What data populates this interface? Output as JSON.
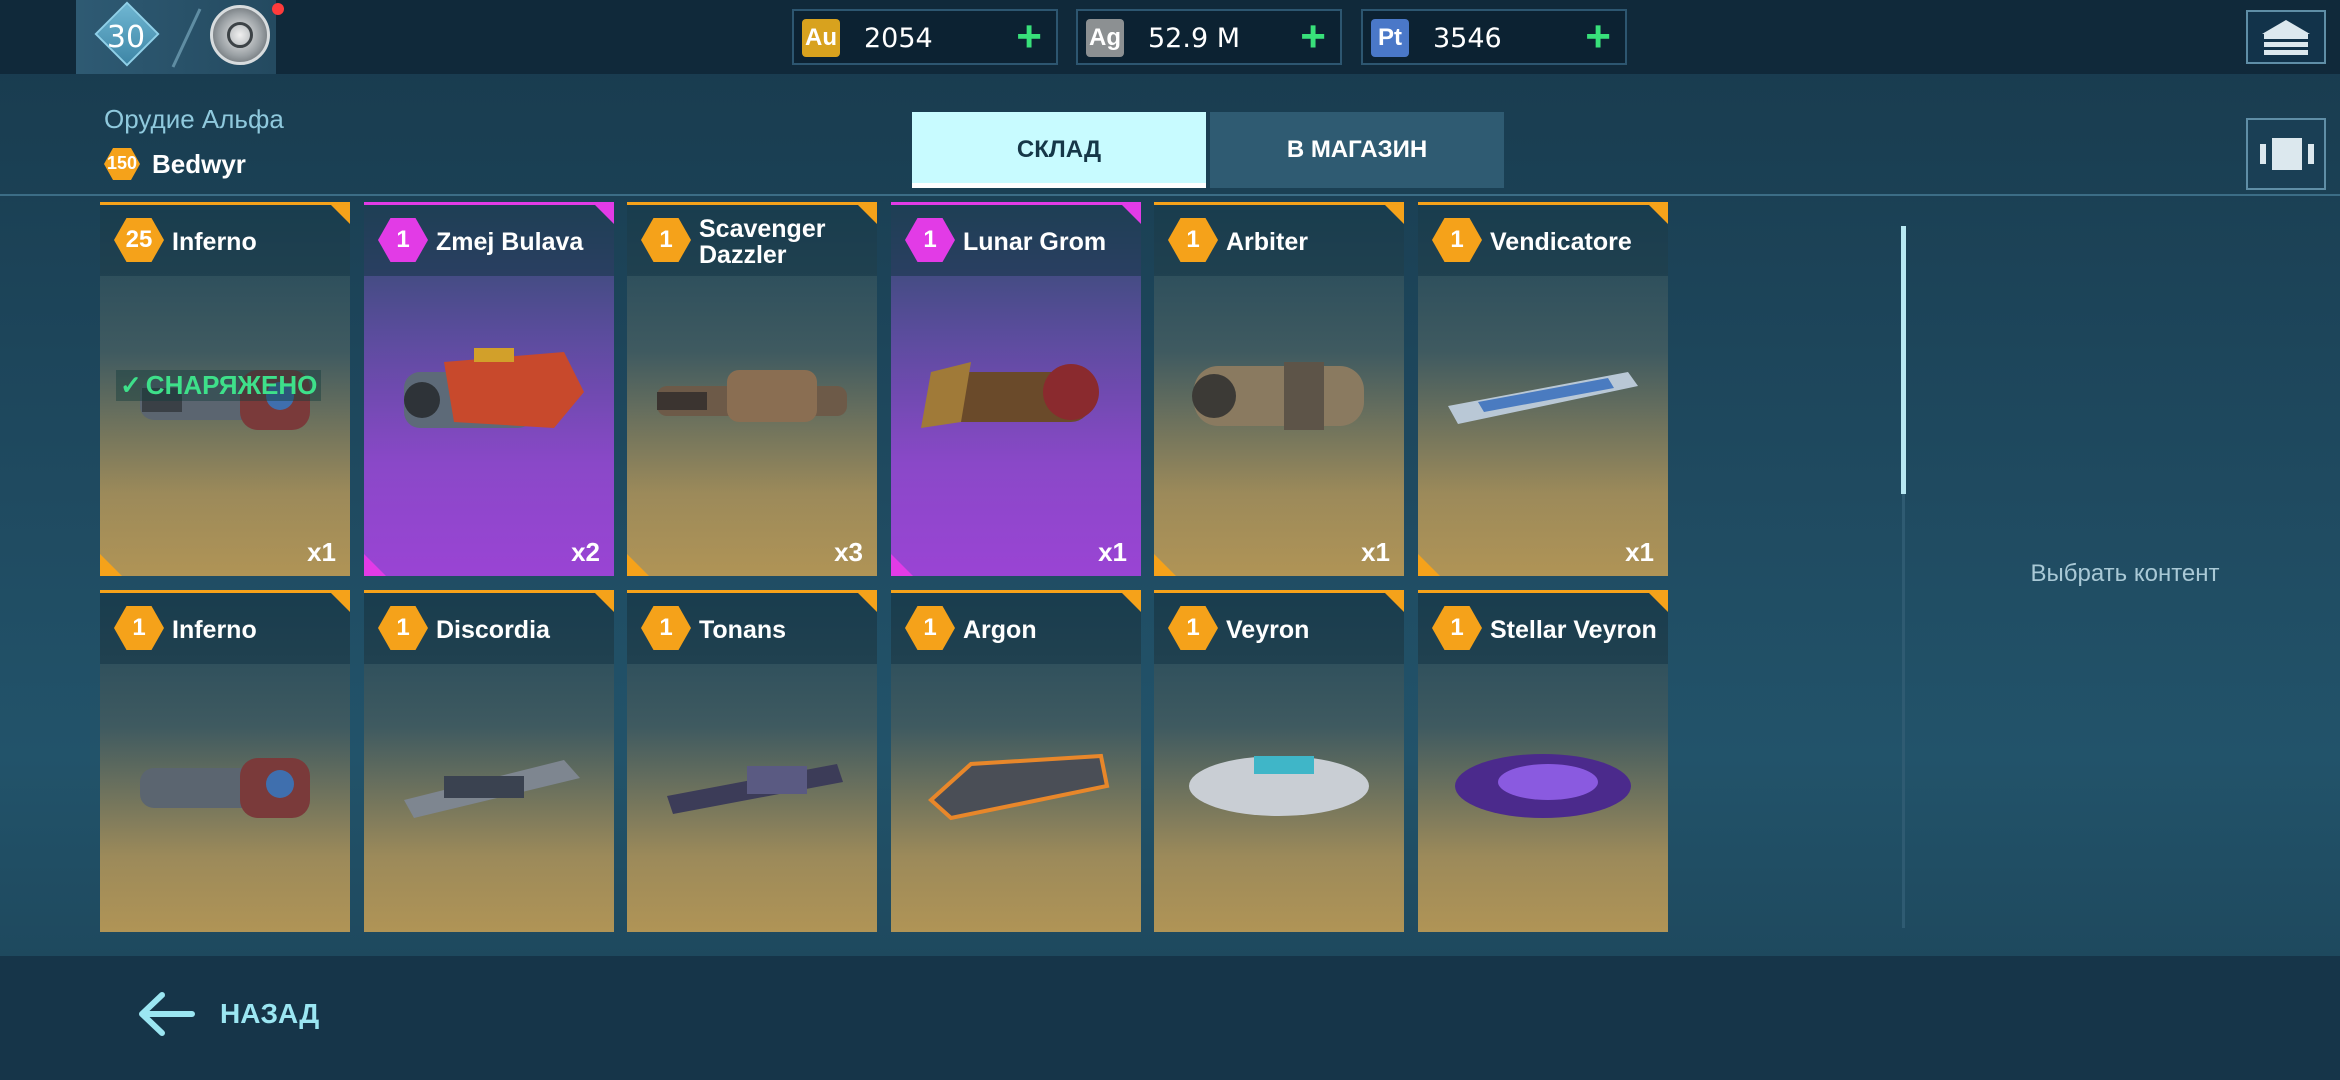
{
  "topbar": {
    "player_level": "30",
    "currencies": [
      {
        "code": "Au",
        "value": "2054",
        "badge_color": "#d8a21e"
      },
      {
        "code": "Ag",
        "value": "52.9 M",
        "badge_color": "#8c9092"
      },
      {
        "code": "Pt",
        "value": "3546",
        "badge_color": "#4a78c8"
      }
    ],
    "plus_symbol": "+"
  },
  "header": {
    "slot_title": "Орудие Альфа",
    "owner_level": "150",
    "owner_name": "Bedwyr"
  },
  "tabs": [
    {
      "label": "СКЛАД",
      "active": true
    },
    {
      "label": "В МАГАЗИН",
      "active": false
    }
  ],
  "weapons": [
    {
      "level": "25",
      "name": "Inferno",
      "rarity": "orange",
      "qty": "x1",
      "equipped_label": "СНАРЯЖЕНО",
      "icon": "inferno-gun-icon"
    },
    {
      "level": "1",
      "name": "Zmej Bulava",
      "rarity": "purple",
      "qty": "x2",
      "icon": "zmej-bulava-gun-icon"
    },
    {
      "level": "1",
      "name": "Scavenger Dazzler",
      "rarity": "orange",
      "qty": "x3",
      "icon": "scavenger-dazzler-gun-icon"
    },
    {
      "level": "1",
      "name": "Lunar Grom",
      "rarity": "purple",
      "qty": "x1",
      "icon": "lunar-grom-gun-icon"
    },
    {
      "level": "1",
      "name": "Arbiter",
      "rarity": "orange",
      "qty": "x1",
      "icon": "arbiter-gun-icon"
    },
    {
      "level": "1",
      "name": "Vendicatore",
      "rarity": "orange",
      "qty": "x1",
      "icon": "vendicatore-gun-icon"
    },
    {
      "level": "1",
      "name": "Inferno",
      "rarity": "orange",
      "qty": "",
      "icon": "inferno-gun-icon"
    },
    {
      "level": "1",
      "name": "Discordia",
      "rarity": "orange",
      "qty": "",
      "icon": "discordia-gun-icon"
    },
    {
      "level": "1",
      "name": "Tonans",
      "rarity": "orange",
      "qty": "",
      "icon": "tonans-gun-icon"
    },
    {
      "level": "1",
      "name": "Argon",
      "rarity": "orange",
      "qty": "",
      "icon": "argon-gun-icon"
    },
    {
      "level": "1",
      "name": "Veyron",
      "rarity": "orange",
      "qty": "",
      "icon": "veyron-gun-icon"
    },
    {
      "level": "1",
      "name": "Stellar Veyron",
      "rarity": "orange",
      "qty": "",
      "icon": "stellar-veyron-gun-icon"
    }
  ],
  "side_panel": {
    "placeholder": "Выбрать контент"
  },
  "footer": {
    "back_label": "НАЗАД"
  }
}
